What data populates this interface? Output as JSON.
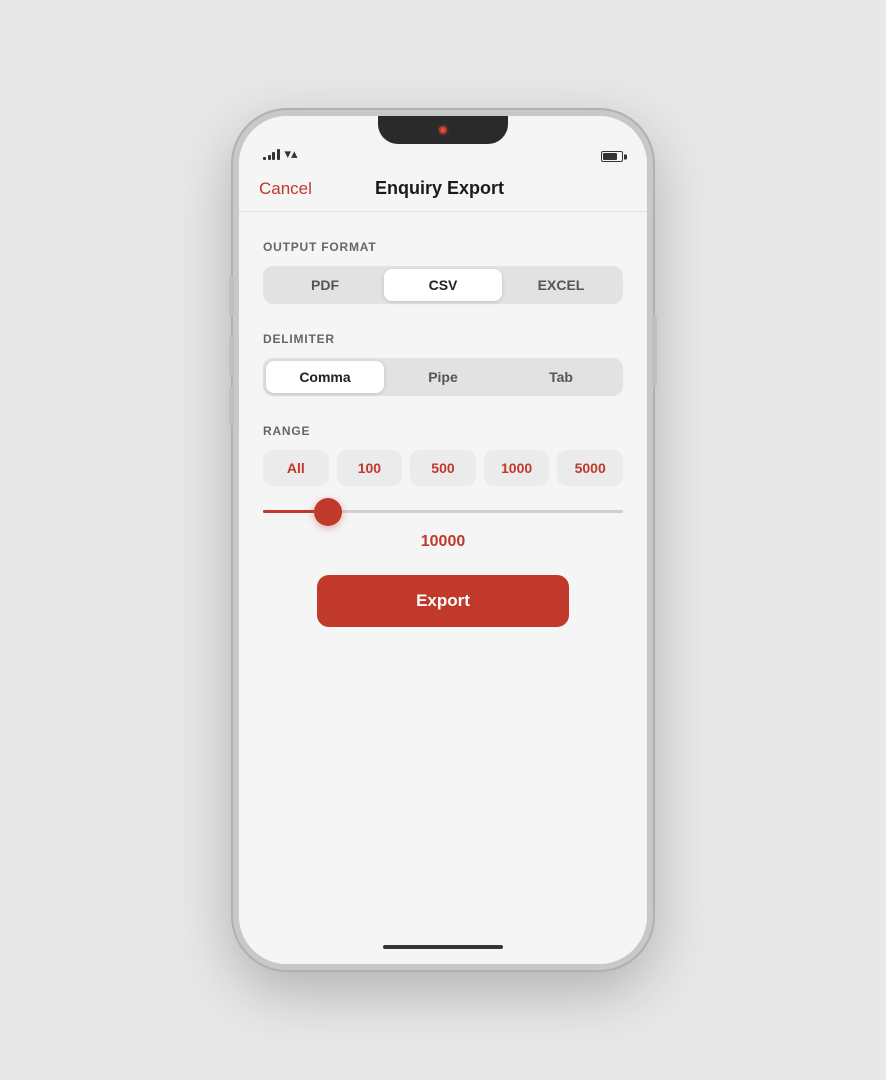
{
  "statusBar": {
    "signalBars": [
      3,
      5,
      7,
      9,
      11
    ],
    "battery_level": 75
  },
  "nav": {
    "cancel_label": "Cancel",
    "title": "Enquiry Export"
  },
  "outputFormat": {
    "section_label": "OUTPUT FORMAT",
    "options": [
      "PDF",
      "CSV",
      "EXCEL"
    ],
    "active": "CSV"
  },
  "delimiter": {
    "section_label": "DELIMITER",
    "options": [
      "Comma",
      "Pipe",
      "Tab"
    ],
    "active": "Comma"
  },
  "range": {
    "section_label": "RANGE",
    "options": [
      "All",
      "100",
      "500",
      "1000",
      "5000"
    ],
    "active": "All"
  },
  "slider": {
    "value": "10000",
    "min": 0,
    "max": 100000,
    "current": 10000
  },
  "export": {
    "button_label": "Export"
  }
}
